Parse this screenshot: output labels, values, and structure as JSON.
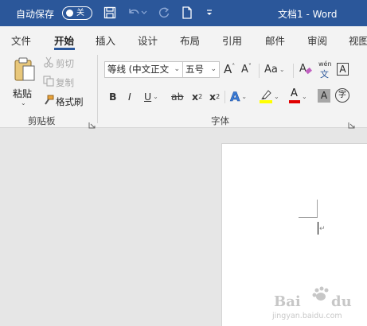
{
  "titlebar": {
    "autosave_label": "自动保存",
    "toggle_state": "关",
    "document_title": "文档1 - Word",
    "bg_color": "#2b579a"
  },
  "tabs": [
    {
      "label": "文件"
    },
    {
      "label": "开始",
      "active": true
    },
    {
      "label": "插入"
    },
    {
      "label": "设计"
    },
    {
      "label": "布局"
    },
    {
      "label": "引用"
    },
    {
      "label": "邮件"
    },
    {
      "label": "审阅"
    },
    {
      "label": "视图"
    }
  ],
  "clipboard": {
    "paste_label": "粘贴",
    "cut_label": "剪切",
    "copy_label": "复制",
    "format_painter_label": "格式刷",
    "group_label": "剪贴板"
  },
  "font": {
    "font_name": "等线 (中文正文",
    "font_size": "五号",
    "grow_label": "A",
    "shrink_label": "A",
    "case_label": "Aa",
    "pinyin_top": "wén",
    "pinyin_bottom": "文",
    "border_char_label": "A",
    "bold_label": "B",
    "italic_label": "I",
    "underline_label": "U",
    "strike_label": "ab",
    "subscript_label": "x",
    "subscript_small": "2",
    "superscript_label": "x",
    "superscript_small": "2",
    "effects_label": "A",
    "highlight_color": "#ffff00",
    "font_color_label": "A",
    "font_color": "#e00000",
    "shading_label": "A",
    "enclose_label": "字",
    "group_label": "字体"
  },
  "watermark": {
    "logo_text": "Bai du",
    "sub_text": "jingyan.baidu.com"
  }
}
